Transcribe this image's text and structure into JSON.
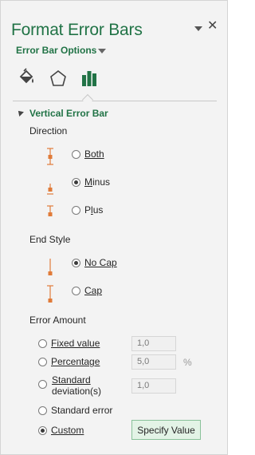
{
  "pane": {
    "title": "Format Error Bars",
    "close_glyph": "✕",
    "options_menu": "Error Bar Options",
    "tabs": [
      {
        "name": "fill-line-icon"
      },
      {
        "name": "effects-icon"
      },
      {
        "name": "error-bar-options-icon",
        "selected": true
      }
    ]
  },
  "vertical": {
    "section_title": "Vertical Error Bar",
    "direction_label": "Direction",
    "direction_options": [
      {
        "label": "Both",
        "checked": false
      },
      {
        "label": "Minus",
        "checked": true
      },
      {
        "label": "Plus",
        "checked": false
      }
    ],
    "endstyle_label": "End Style",
    "endstyle_options": [
      {
        "label": "No Cap",
        "checked": true
      },
      {
        "label": "Cap",
        "checked": false
      }
    ],
    "amount_label": "Error Amount",
    "amount_options": [
      {
        "label": "Fixed value",
        "checked": false,
        "value": "1,0"
      },
      {
        "label": "Percentage",
        "checked": false,
        "value": "5,0",
        "unit": "%"
      },
      {
        "label_line1": "Standard",
        "label_line2": "deviation(s)",
        "checked": false,
        "value": "1,0"
      },
      {
        "label": "Standard error",
        "checked": false
      },
      {
        "label": "Custom",
        "checked": true
      }
    ],
    "specify_button": "Specify Value"
  },
  "colors": {
    "accent_green": "#217346",
    "icon_orange": "#e07b39",
    "button_bg": "#e3f3e6"
  }
}
